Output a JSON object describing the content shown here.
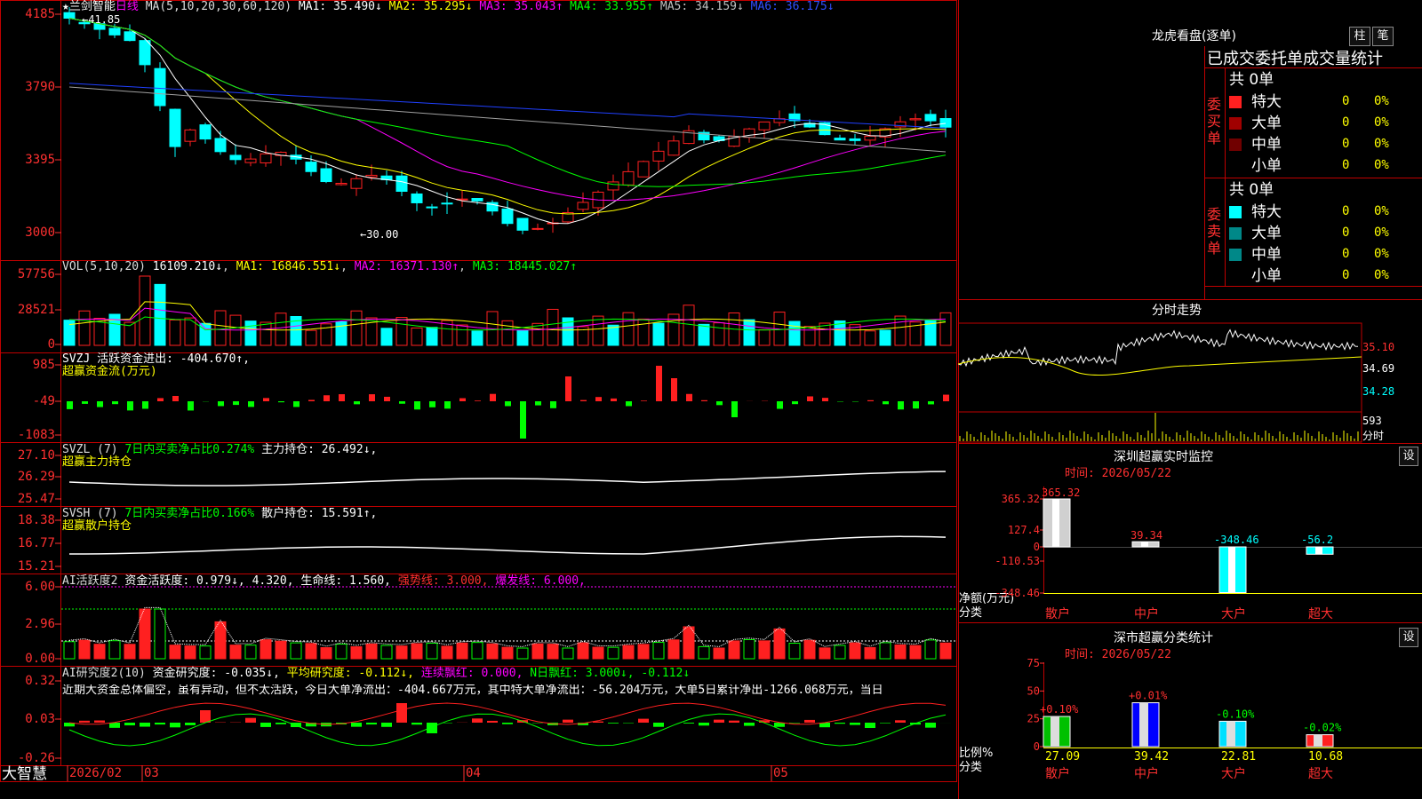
{
  "stock": {
    "name": "兰剑智能",
    "period": "日线",
    "star": "★"
  },
  "main": {
    "ma_label": "MA(5,10,20,30,60,120)",
    "ma": [
      {
        "name": "MA1:",
        "val": "35.490↓",
        "color": "#ffffff"
      },
      {
        "name": "MA2:",
        "val": "35.295↓",
        "color": "#ffff00"
      },
      {
        "name": "MA3:",
        "val": "35.043↑",
        "color": "#ff00ff"
      },
      {
        "name": "MA4:",
        "val": "33.955↑",
        "color": "#00ff00"
      },
      {
        "name": "MA5:",
        "val": "34.159↓",
        "color": "#c0c0c0"
      },
      {
        "name": "MA6:",
        "val": "36.175↓",
        "color": "#0000ff"
      }
    ],
    "yticks": [
      "4185",
      "3790",
      "3395",
      "3000"
    ],
    "high_note": "41.85",
    "low_note": "30.00"
  },
  "vol": {
    "label": "VOL(5,10,20)",
    "value": "16109.210↓",
    "ma1": "MA1: 16846.551↓",
    "ma2": "MA2: 16371.130↑",
    "ma3": "MA3: 18445.027↑",
    "yticks": [
      "57756",
      "28521",
      "0"
    ]
  },
  "svzj": {
    "label": "SVZJ  活跃资金进出: -404.670↑,",
    "sub": "超赢资金流(万元)",
    "yticks": [
      "985",
      "-49",
      "-1083"
    ]
  },
  "svzl": {
    "label": "SVZL (7)",
    "t1": "7日内买卖净占比0.274%",
    "t2": "主力持仓: 26.492↓,",
    "sub": "超赢主力持仓",
    "yticks": [
      "27.10",
      "26.29",
      "25.47"
    ]
  },
  "svsh": {
    "label": "SVSH (7)",
    "t1": "7日内买卖净占比0.166%",
    "t2": "散户持仓: 15.591↑,",
    "sub": "超赢散户持仓",
    "yticks": [
      "18.38",
      "16.77",
      "15.21"
    ]
  },
  "ai1": {
    "label": "AI活跃度2",
    "t1": "资金活跃度: 0.979↓, 4.320, 生命线: 1.560,",
    "t2": "强势线: 3.000,",
    "t3": "爆发线: 6.000,",
    "yticks": [
      "6.00",
      "2.96",
      "0.00"
    ]
  },
  "ai2": {
    "label": "AI研究度2(10)",
    "t1": "资金研究度: -0.035↓,",
    "t2": "平均研究度: -0.112↓,",
    "t3": "连续飘红: 0.000,",
    "t4": "N日飘红: 3.000↓, -0.112↓",
    "comment": "近期大资金总体偏空，虽有异动，但不太活跃，今日大单净流出：-404.667万元，其中特大单净流出：-56.204万元，大单5日累计净出-1266.068万元，当日",
    "yticks": [
      "0.32",
      "0.03",
      "-0.26"
    ]
  },
  "xaxis": {
    "brand": "大智慧",
    "labels": [
      "2026/02",
      "03",
      "04",
      "05"
    ]
  },
  "dragon": {
    "title": "龙虎看盘(逐单)",
    "btn1": "柱",
    "btn2": "笔",
    "head": "已成交委托单成交量统计",
    "buy": {
      "side": "委买单",
      "total": "共 0单",
      "rows": [
        {
          "name": "特大",
          "n": "0",
          "p": "0%"
        },
        {
          "name": "大单",
          "n": "0",
          "p": "0%"
        },
        {
          "name": "中单",
          "n": "0",
          "p": "0%"
        },
        {
          "name": "小单",
          "n": "0",
          "p": "0%"
        }
      ]
    },
    "sell": {
      "side": "委卖单",
      "total": "共 0单",
      "rows": [
        {
          "name": "特大",
          "n": "0",
          "p": "0%"
        },
        {
          "name": "大单",
          "n": "0",
          "p": "0%"
        },
        {
          "name": "中单",
          "n": "0",
          "p": "0%"
        },
        {
          "name": "小单",
          "n": "0",
          "p": "0%"
        }
      ]
    }
  },
  "intraday": {
    "title": "分时走势",
    "prices": [
      "35.10",
      "34.69",
      "34.28"
    ],
    "vol": "593",
    "vol_unit": "分时"
  },
  "monitor": {
    "title": "深圳超赢实时监控",
    "btn": "设",
    "time": "时间: 2026/05/22",
    "yticks": [
      "365.32",
      "127.4",
      "0",
      "-110.53",
      "-348.46"
    ],
    "unit1": "净额(万元)",
    "unit2": "分类",
    "bars": [
      {
        "name": "散户",
        "value": 365.32,
        "label": "365.32"
      },
      {
        "name": "中户",
        "value": 39.34,
        "label": "39.34"
      },
      {
        "name": "大户",
        "value": -348.46,
        "label": "-348.46"
      },
      {
        "name": "超大",
        "value": -56.2,
        "label": "-56.2"
      }
    ]
  },
  "classify": {
    "title": "深市超赢分类统计",
    "btn": "设",
    "time": "时间: 2026/05/22",
    "yticks": [
      "75",
      "50",
      "25",
      "0"
    ],
    "unit1": "比例%",
    "unit2": "分类",
    "bars": [
      {
        "name": "散户",
        "value": 27.09,
        "delta": "+0.10%"
      },
      {
        "name": "中户",
        "value": 39.42,
        "delta": "+0.01%"
      },
      {
        "name": "大户",
        "value": 22.81,
        "delta": "-0.10%"
      },
      {
        "name": "超大",
        "value": 10.68,
        "delta": "-0.02%"
      }
    ]
  },
  "colors": {
    "up": "#ff2020",
    "down": "#00ffff",
    "grid": "#c00000",
    "green": "#00ff00",
    "yellow": "#ffff00",
    "magenta": "#ff00ff"
  }
}
